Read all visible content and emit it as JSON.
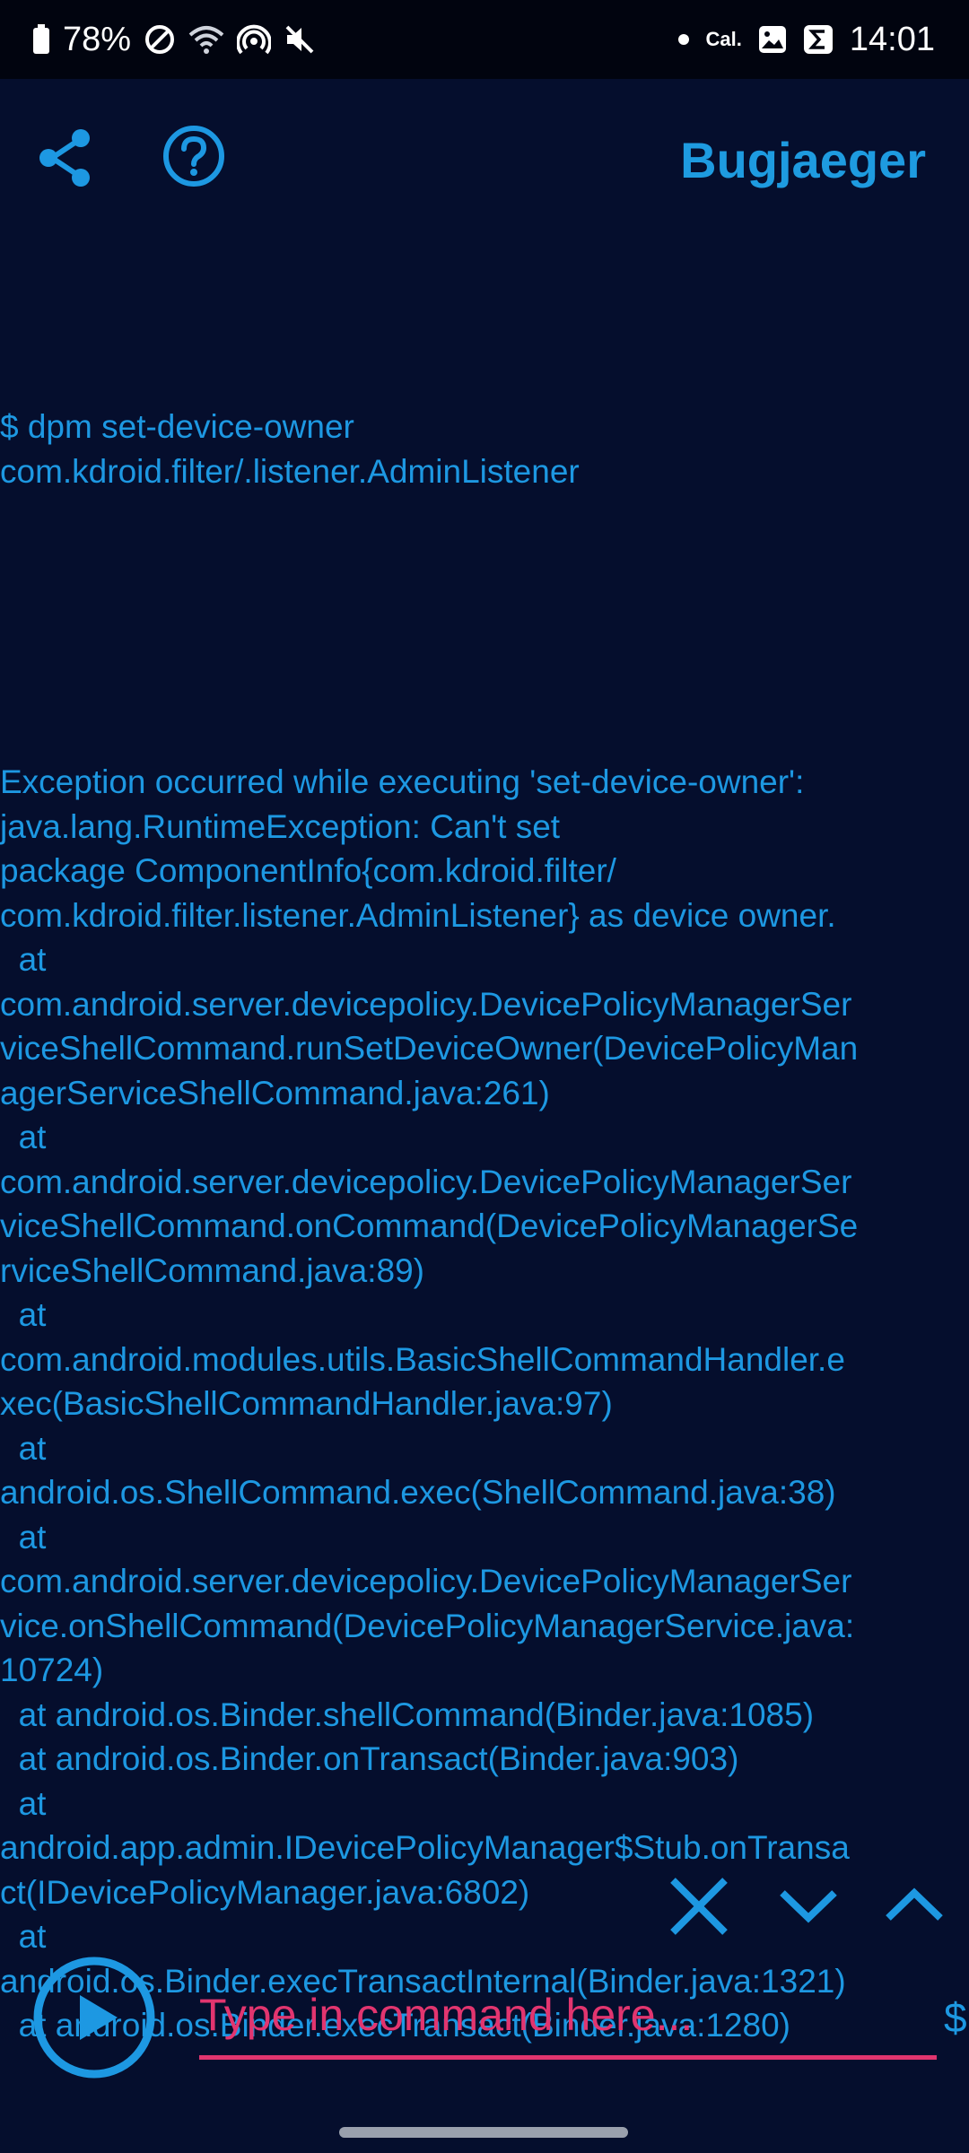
{
  "status_bar": {
    "battery": "78%",
    "carrier_badge": "Cal.",
    "time": "14:01"
  },
  "app_bar": {
    "title": "Bugjaeger",
    "icons": [
      "share-icon",
      "help-icon"
    ]
  },
  "terminal": {
    "command": "$ dpm set-device-owner\ncom.kdroid.filter/.listener.AdminListener",
    "output": "Exception occurred while executing 'set-device-owner':\njava.lang.RuntimeException: Can't set\npackage ComponentInfo{com.kdroid.filter/\ncom.kdroid.filter.listener.AdminListener} as device owner.\n  at\ncom.android.server.devicepolicy.DevicePolicyManagerSer\nviceShellCommand.runSetDeviceOwner(DevicePolicyMan\nagerServiceShellCommand.java:261)\n  at\ncom.android.server.devicepolicy.DevicePolicyManagerSer\nviceShellCommand.onCommand(DevicePolicyManagerSe\nrviceShellCommand.java:89)\n  at\ncom.android.modules.utils.BasicShellCommandHandler.e\nxec(BasicShellCommandHandler.java:97)\n  at\nandroid.os.ShellCommand.exec(ShellCommand.java:38)\n  at\ncom.android.server.devicepolicy.DevicePolicyManagerSer\nvice.onShellCommand(DevicePolicyManagerService.java:\n10724)\n  at android.os.Binder.shellCommand(Binder.java:1085)\n  at android.os.Binder.onTransact(Binder.java:903)\n  at\nandroid.app.admin.IDevicePolicyManager$Stub.onTransa\nct(IDevicePolicyManager.java:6802)\n  at\nandroid.os.Binder.execTransactInternal(Binder.java:1321)\n  at android.os.Binder.execTransact(Binder.java:1280)"
  },
  "search_controls": {
    "icons": [
      "close-icon",
      "chevron-down-icon",
      "chevron-up-icon"
    ]
  },
  "command_bar": {
    "run_icon": "play-icon",
    "placeholder": "Type in command here...",
    "prompt_symbol": "$"
  },
  "colors": {
    "background": "#050e2d",
    "status_bar_bg": "#01040f",
    "accent": "#1d98e2",
    "input_accent": "#e2356f"
  }
}
